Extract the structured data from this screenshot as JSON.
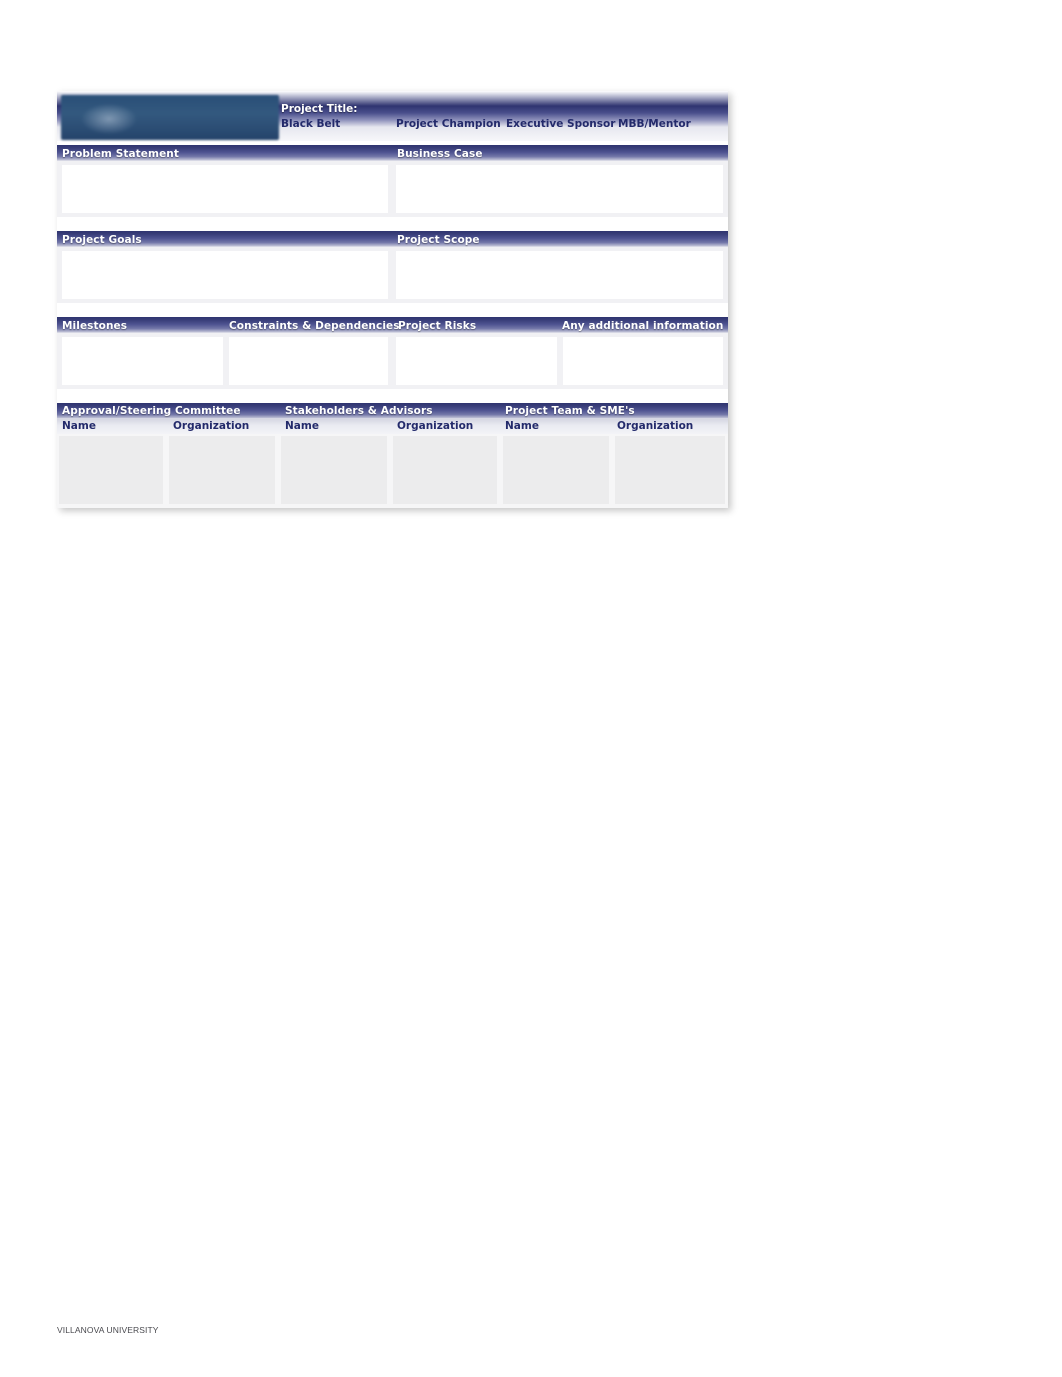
{
  "document": {
    "type": "Six Sigma Project Charter form",
    "footer_text": "VILLANOVA UNIVERSITY"
  },
  "colors": {
    "bar_dark": "#2f3470",
    "bar_light": "#b9bbd2",
    "label_white": "#ffffff",
    "label_navy": "#232a6b",
    "logo_blue": "#2c5179",
    "cell_white": "#ffffff",
    "cell_grey": "#ececed",
    "page_bg": "#ffffff"
  },
  "header": {
    "logo_alt": "university-logo",
    "project_title_label": "Project Title:",
    "roles": [
      {
        "label": "Black Belt",
        "value": ""
      },
      {
        "label": "Project Champion",
        "value": ""
      },
      {
        "label": "Executive Sponsor",
        "value": ""
      },
      {
        "label": "MBB/Mentor",
        "value": ""
      }
    ]
  },
  "sections": {
    "row1": [
      {
        "label": "Problem Statement",
        "value": ""
      },
      {
        "label": "Business Case",
        "value": ""
      }
    ],
    "row2": [
      {
        "label": "Project Goals",
        "value": ""
      },
      {
        "label": "Project Scope",
        "value": ""
      }
    ],
    "row3": [
      {
        "label": "Milestones",
        "value": ""
      },
      {
        "label": "Constraints & Dependencies",
        "value": ""
      },
      {
        "label": "Project Risks",
        "value": ""
      },
      {
        "label": "Any additional information",
        "value": ""
      }
    ]
  },
  "people": {
    "groups": [
      {
        "title": "Approval/Steering Committee",
        "columns": [
          "Name",
          "Organization"
        ],
        "rows": [
          {
            "name": "",
            "organization": ""
          },
          {
            "name": "",
            "organization": ""
          },
          {
            "name": "",
            "organization": ""
          },
          {
            "name": "",
            "organization": ""
          }
        ]
      },
      {
        "title": "Stakeholders & Advisors",
        "columns": [
          "Name",
          "Organization"
        ],
        "rows": [
          {
            "name": "",
            "organization": ""
          },
          {
            "name": "",
            "organization": ""
          },
          {
            "name": "",
            "organization": ""
          },
          {
            "name": "",
            "organization": ""
          }
        ]
      },
      {
        "title": "Project Team & SME's",
        "columns": [
          "Name",
          "Organization"
        ],
        "rows": [
          {
            "name": "",
            "organization": ""
          },
          {
            "name": "",
            "organization": ""
          },
          {
            "name": "",
            "organization": ""
          },
          {
            "name": "",
            "organization": ""
          }
        ]
      }
    ]
  }
}
